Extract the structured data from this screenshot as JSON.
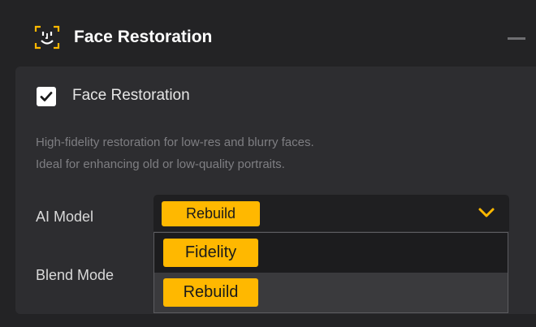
{
  "header": {
    "title": "Face Restoration",
    "icon": "face-scan-icon",
    "accent_color": "#ffb800"
  },
  "panel": {
    "checkbox_label": "Face Restoration",
    "checkbox_checked": true,
    "description": [
      "High-fidelity restoration for low-res and blurry faces.",
      "Ideal for enhancing old or low-quality portraits."
    ],
    "ai_model": {
      "label": "AI Model",
      "selected": "Rebuild",
      "options": [
        "Fidelity",
        "Rebuild"
      ]
    },
    "blend_mode": {
      "label": "Blend Mode"
    }
  }
}
